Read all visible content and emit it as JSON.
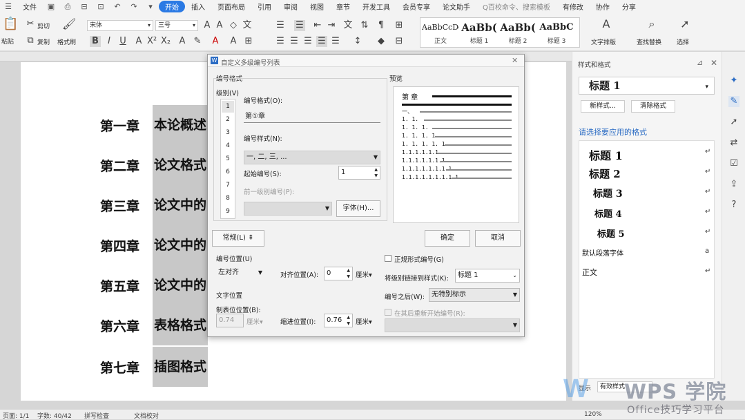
{
  "menubar": {
    "file": "文件",
    "start": "开始",
    "insert": "插入",
    "layout": "页面布局",
    "refs": "引用",
    "review": "审阅",
    "view": "视图",
    "chapter": "章节",
    "dev": "开发工具",
    "member": "会员专享",
    "paper": "论文助手",
    "search": "Q百校命令、搜索模板",
    "edited": "有修改",
    "collab": "协作",
    "share": "分享"
  },
  "ribbon": {
    "paste": "粘贴",
    "cut": "剪切",
    "copy": "复制",
    "format_painter": "格式刷",
    "font": "宋体",
    "size": "三号",
    "text_style": "文字排版",
    "find_replace": "查找替换",
    "select": "选择",
    "styles": [
      {
        "sample": "AaBbCcDd",
        "name": "正文"
      },
      {
        "sample": "AaBb(",
        "name": "标题 1"
      },
      {
        "sample": "AaBb(",
        "name": "标题 2"
      },
      {
        "sample": "AaBbC",
        "name": "标题 3"
      }
    ]
  },
  "chapters": [
    {
      "num": "第一章",
      "title": "本论概述"
    },
    {
      "num": "第二章",
      "title": "论文格式"
    },
    {
      "num": "第三章",
      "title": "论文中的"
    },
    {
      "num": "第四章",
      "title": "论文中的"
    },
    {
      "num": "第五章",
      "title": "论文中的"
    },
    {
      "num": "第六章",
      "title": "表格格式"
    },
    {
      "num": "第七章",
      "title": "插图格式"
    }
  ],
  "status": {
    "page": "页面: 1/1",
    "words": "字数: 40/42",
    "spell": "拼写检查",
    "doc_check": "文档校对",
    "zoom": "120%"
  },
  "panel": {
    "title": "样式和格式",
    "current": "标题 1",
    "new_style": "新样式...",
    "clear": "清除格式",
    "prompt": "请选择要应用的格式",
    "items": [
      {
        "label": "标题 1",
        "size": 16
      },
      {
        "label": "标题 2",
        "size": 15
      },
      {
        "label": "标题 3",
        "size": 14
      },
      {
        "label": "标题 4",
        "size": 13
      },
      {
        "label": "标题 5",
        "size": 13
      },
      {
        "label": "默认段落字体",
        "size": 10
      },
      {
        "label": "正文",
        "size": 11
      }
    ],
    "show_label": "显示",
    "show_value": "有效样式"
  },
  "dialog": {
    "title": "自定义多级编号列表",
    "numfmt_group": "编号格式",
    "level_label": "级别(V)",
    "levels": [
      "1",
      "2",
      "3",
      "4",
      "5",
      "6",
      "7",
      "8",
      "9"
    ],
    "format_label": "编号格式(O):",
    "format_value": "第①章",
    "style_label": "编号样式(N):",
    "style_value": "一, 二, 三, ...",
    "start_label": "起始编号(S):",
    "start_value": "1",
    "prev_label": "前一级别编号(P):",
    "font_btn": "字体(H)...",
    "preview_label": "预览",
    "preview_lines": [
      "第 章",
      "一、",
      "1. 1.",
      "1. 1. 1.",
      "1. 1. 1. 1.",
      "1. 1. 1. 1. 1.",
      "1.1.1.1.1.1.",
      "1.1.1.1.1.1.1.",
      "1.1.1.1.1.1.1.1.",
      "1.1.1.1.1.1.1.1.1."
    ],
    "normal_btn": "常规(L)",
    "ok": "确定",
    "cancel": "取消",
    "numpos_group": "编号位置(U)",
    "align_value": "左对齐",
    "align_pos_label": "对齐位置(A):",
    "align_pos_value": "0",
    "unit": "厘米",
    "textpos_group": "文字位置",
    "tab_label": "制表位位置(B):",
    "tab_value": "0.74",
    "indent_label": "缩进位置(I):",
    "indent_value": "0.76",
    "legal": "正规形式编号(G)",
    "link_label": "将级别链接到样式(K):",
    "link_value": "标题 1",
    "after_label": "编号之后(W):",
    "after_value": "无特别标示",
    "restart": "在其后重新开始编号(R):"
  },
  "watermark": {
    "brand": "WPS 学院",
    "slogan": "Office技巧学习平台"
  }
}
